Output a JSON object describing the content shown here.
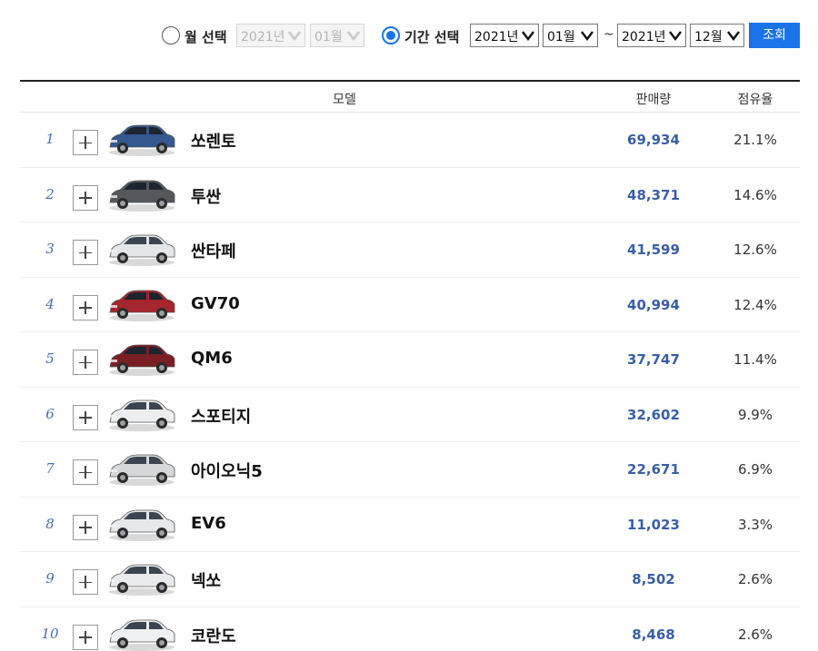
{
  "filter": {
    "month_option_label": "월 선택",
    "month_year": "2021년",
    "month_month": "01월",
    "period_option_label": "기간 선택",
    "start_year": "2021년",
    "start_month": "01월",
    "separator": "~",
    "end_year": "2021년",
    "end_month": "12월",
    "search_label": "조회",
    "selected_option": "period",
    "accent_color": "#1a73e8"
  },
  "table": {
    "headers": {
      "model": "모델",
      "sales": "판매량",
      "share": "점유율"
    },
    "rows": [
      {
        "rank": "1",
        "model": "쏘렌토",
        "sales": "69,934",
        "share": "21.1%",
        "car_color": "#34588f",
        "car_icon": "suv-icon"
      },
      {
        "rank": "2",
        "model": "투싼",
        "sales": "48,371",
        "share": "14.6%",
        "car_color": "#55585c",
        "car_icon": "suv-icon"
      },
      {
        "rank": "3",
        "model": "싼타페",
        "sales": "41,599",
        "share": "12.6%",
        "car_color": "#e4e6e8",
        "car_icon": "suv-icon"
      },
      {
        "rank": "4",
        "model": "GV70",
        "sales": "40,994",
        "share": "12.4%",
        "car_color": "#a5262c",
        "car_icon": "suv-icon"
      },
      {
        "rank": "5",
        "model": "QM6",
        "sales": "37,747",
        "share": "11.4%",
        "car_color": "#7a1f24",
        "car_icon": "suv-icon"
      },
      {
        "rank": "6",
        "model": "스포티지",
        "sales": "32,602",
        "share": "9.9%",
        "car_color": "#eceeef",
        "car_icon": "suv-icon"
      },
      {
        "rank": "7",
        "model": "아이오닉5",
        "sales": "22,671",
        "share": "6.9%",
        "car_color": "#d5d7d8",
        "car_icon": "hatchback-icon"
      },
      {
        "rank": "8",
        "model": "EV6",
        "sales": "11,023",
        "share": "3.3%",
        "car_color": "#e6e8ea",
        "car_icon": "crossover-icon"
      },
      {
        "rank": "9",
        "model": "넥쏘",
        "sales": "8,502",
        "share": "2.6%",
        "car_color": "#e8eaec",
        "car_icon": "suv-icon"
      },
      {
        "rank": "10",
        "model": "코란도",
        "sales": "8,468",
        "share": "2.6%",
        "car_color": "#eef0f1",
        "car_icon": "suv-icon"
      }
    ]
  }
}
